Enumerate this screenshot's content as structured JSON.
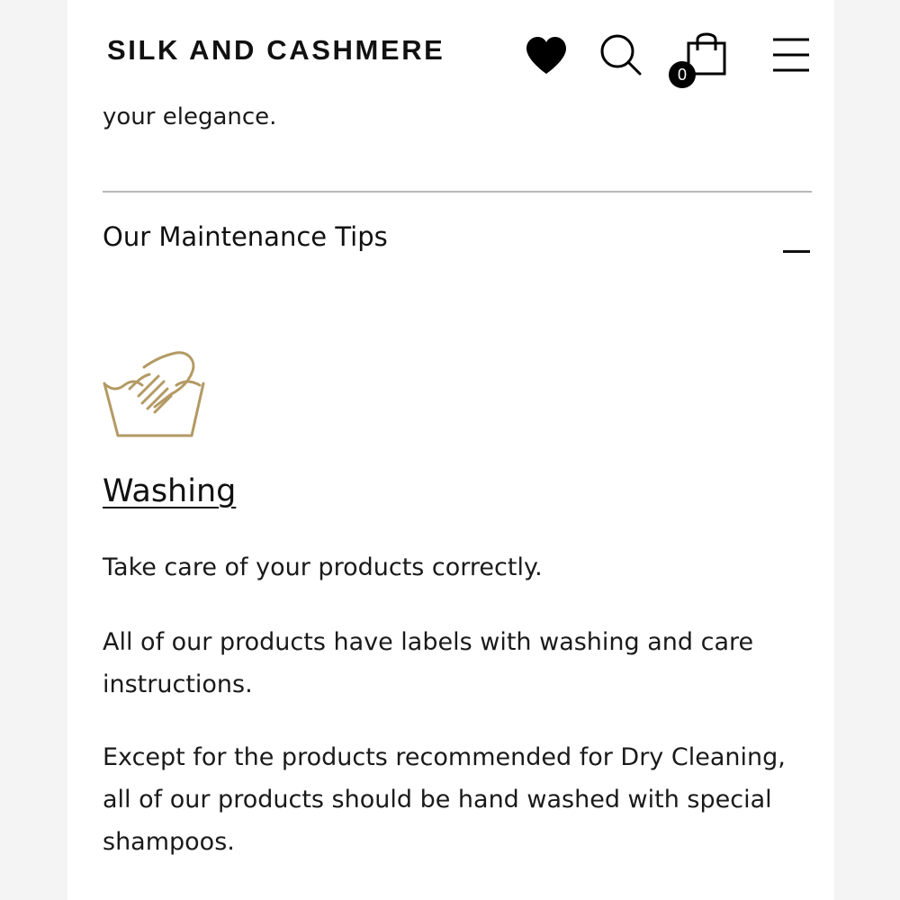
{
  "header": {
    "brand": "SILK AND CASHMERE",
    "icons": {
      "wishlist": "heart-icon",
      "search": "search-icon",
      "cart": "shopping-bag-icon",
      "menu": "hamburger-menu-icon"
    },
    "cart_count": "0"
  },
  "content": {
    "intro_tail": "your elegance.",
    "accordion": {
      "title": "Our Maintenance Tips",
      "state": "expanded",
      "toggle_icon": "minus-icon"
    },
    "section": {
      "icon": "hand-wash-icon",
      "title": "Washing",
      "paragraphs": [
        "Take care of your products correctly.",
        "All of our products have labels with washing and care instructions.",
        "Except for the products recommended for Dry Cleaning, all of our products should be hand washed with special shampoos."
      ]
    }
  },
  "colors": {
    "text": "#111111",
    "divider": "#b8b8b8",
    "icon_accent": "#b39a64",
    "background": "#ffffff",
    "margin_background": "#f4f4f4"
  }
}
